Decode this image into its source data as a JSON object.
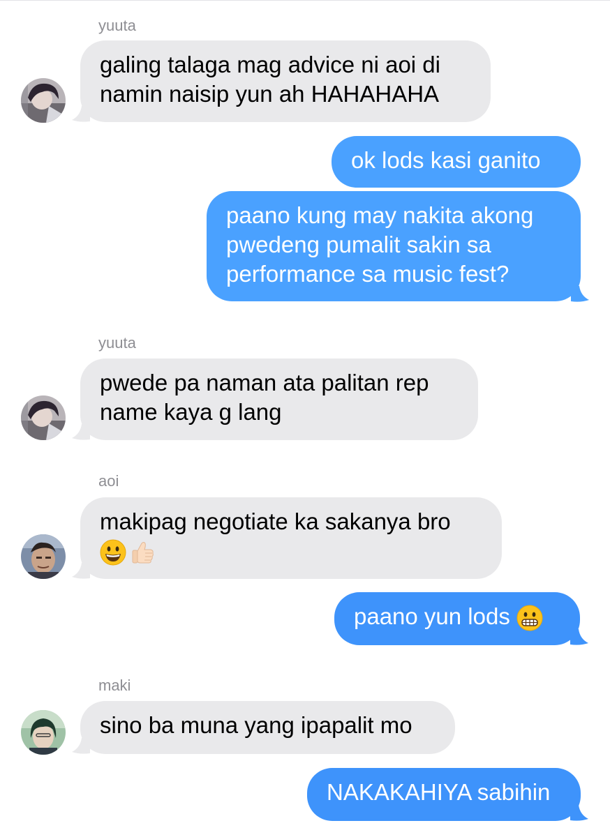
{
  "messages": [
    {
      "sender": "yuuta",
      "lines": [
        "galing talaga mag advice ni aoi di",
        "namin naisip yun ah HAHAHAHA"
      ]
    },
    {
      "lines": [
        "ok lods kasi ganito"
      ]
    },
    {
      "lines": [
        "paano kung may nakita akong",
        "pwedeng pumalit sakin sa",
        "performance sa music fest?"
      ]
    },
    {
      "sender": "yuuta",
      "lines": [
        "pwede pa naman ata palitan rep",
        "name kaya g lang"
      ]
    },
    {
      "sender": "aoi",
      "lines": [
        "makipag negotiate ka sakanya bro"
      ],
      "emoji": [
        "grinning-face",
        "thumbs-up-light-skin"
      ]
    },
    {
      "text": "paano yun lods",
      "emoji": [
        "grimacing-face"
      ]
    },
    {
      "sender": "maki",
      "lines": [
        "sino ba muna yang ipapalit mo"
      ]
    },
    {
      "lines": [
        "NAKAKAHIYA sabihin"
      ]
    }
  ],
  "colors": {
    "incoming_bubble": "#e9e9eb",
    "outgoing_bubble": "#4aa1ff",
    "sender_label": "#8e8e93"
  }
}
